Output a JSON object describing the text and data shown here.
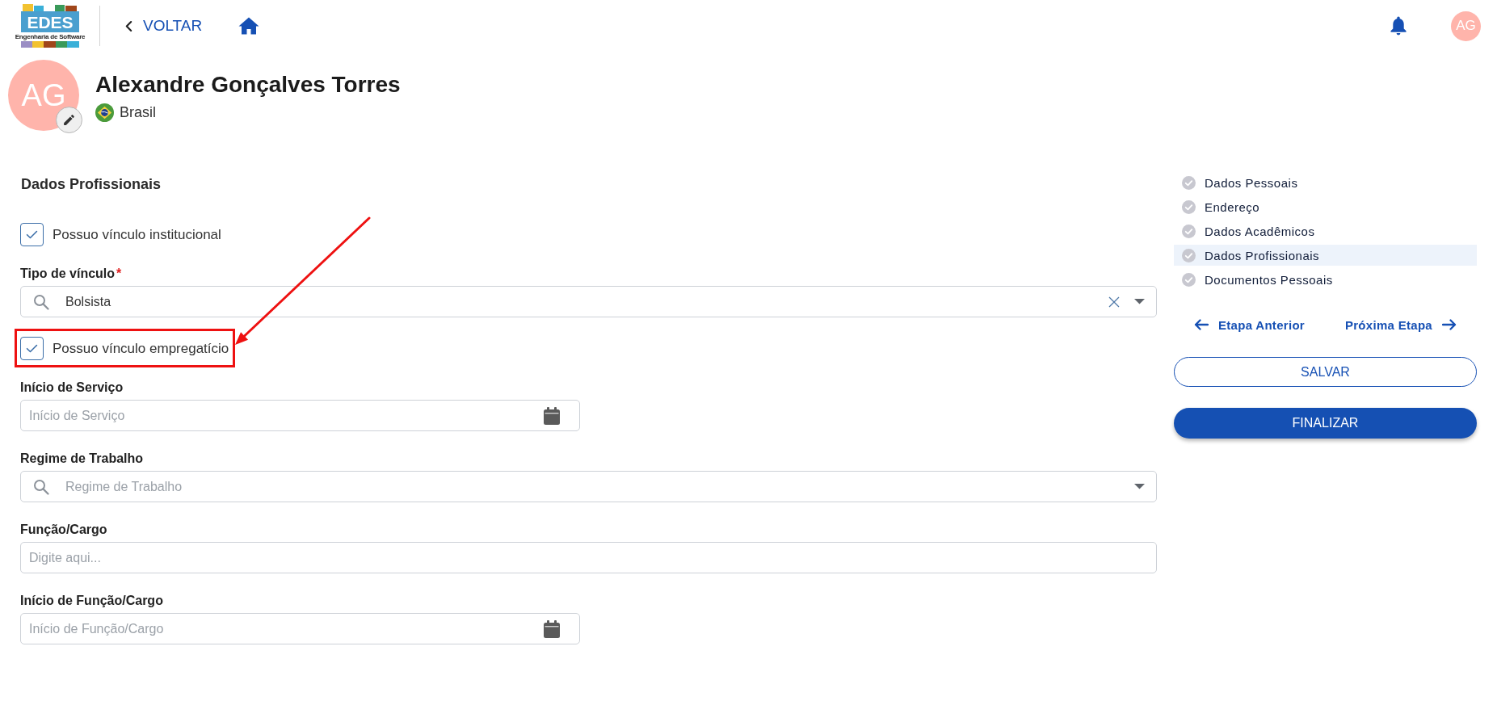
{
  "header": {
    "logo": {
      "title": "EDES",
      "subtitle": "Engenharia de Software"
    },
    "back_link": "VOLTAR",
    "avatar_initials": "AG"
  },
  "profile": {
    "initials": "AG",
    "name": "Alexandre Gonçalves Torres",
    "country": "Brasil"
  },
  "form": {
    "title": "Dados Profissionais",
    "fields": [
      {
        "kind": "checkbox",
        "label": "Possuo vínculo institucional",
        "checked": true,
        "highlighted": false
      },
      {
        "kind": "select",
        "label": "Tipo de vínculo",
        "required_mark": "*",
        "value": "Bolsista"
      },
      {
        "kind": "checkbox",
        "label": "Possuo vínculo empregatício",
        "checked": true,
        "highlighted": true
      },
      {
        "kind": "date",
        "label": "Início de Serviço",
        "placeholder": "Início de Serviço"
      },
      {
        "kind": "select",
        "label": "Regime de Trabalho",
        "placeholder": "Regime de Trabalho"
      },
      {
        "kind": "text",
        "label": "Função/Cargo",
        "placeholder": "Digite aqui..."
      },
      {
        "kind": "date",
        "label": "Início de Função/Cargo",
        "placeholder": "Início de Função/Cargo"
      }
    ]
  },
  "steps": [
    {
      "label": "Dados Pessoais",
      "selected": false
    },
    {
      "label": "Endereço",
      "selected": false
    },
    {
      "label": "Dados Acadêmicos",
      "selected": false
    },
    {
      "label": "Dados Profissionais",
      "selected": true
    },
    {
      "label": "Documentos Pessoais",
      "selected": false
    }
  ],
  "step_nav": {
    "previous": "Etapa Anterior",
    "next": "Próxima Etapa"
  },
  "buttons": [
    {
      "label": "SALVAR",
      "kind": "outline"
    },
    {
      "label": "FINALIZAR",
      "kind": "filled"
    }
  ]
}
